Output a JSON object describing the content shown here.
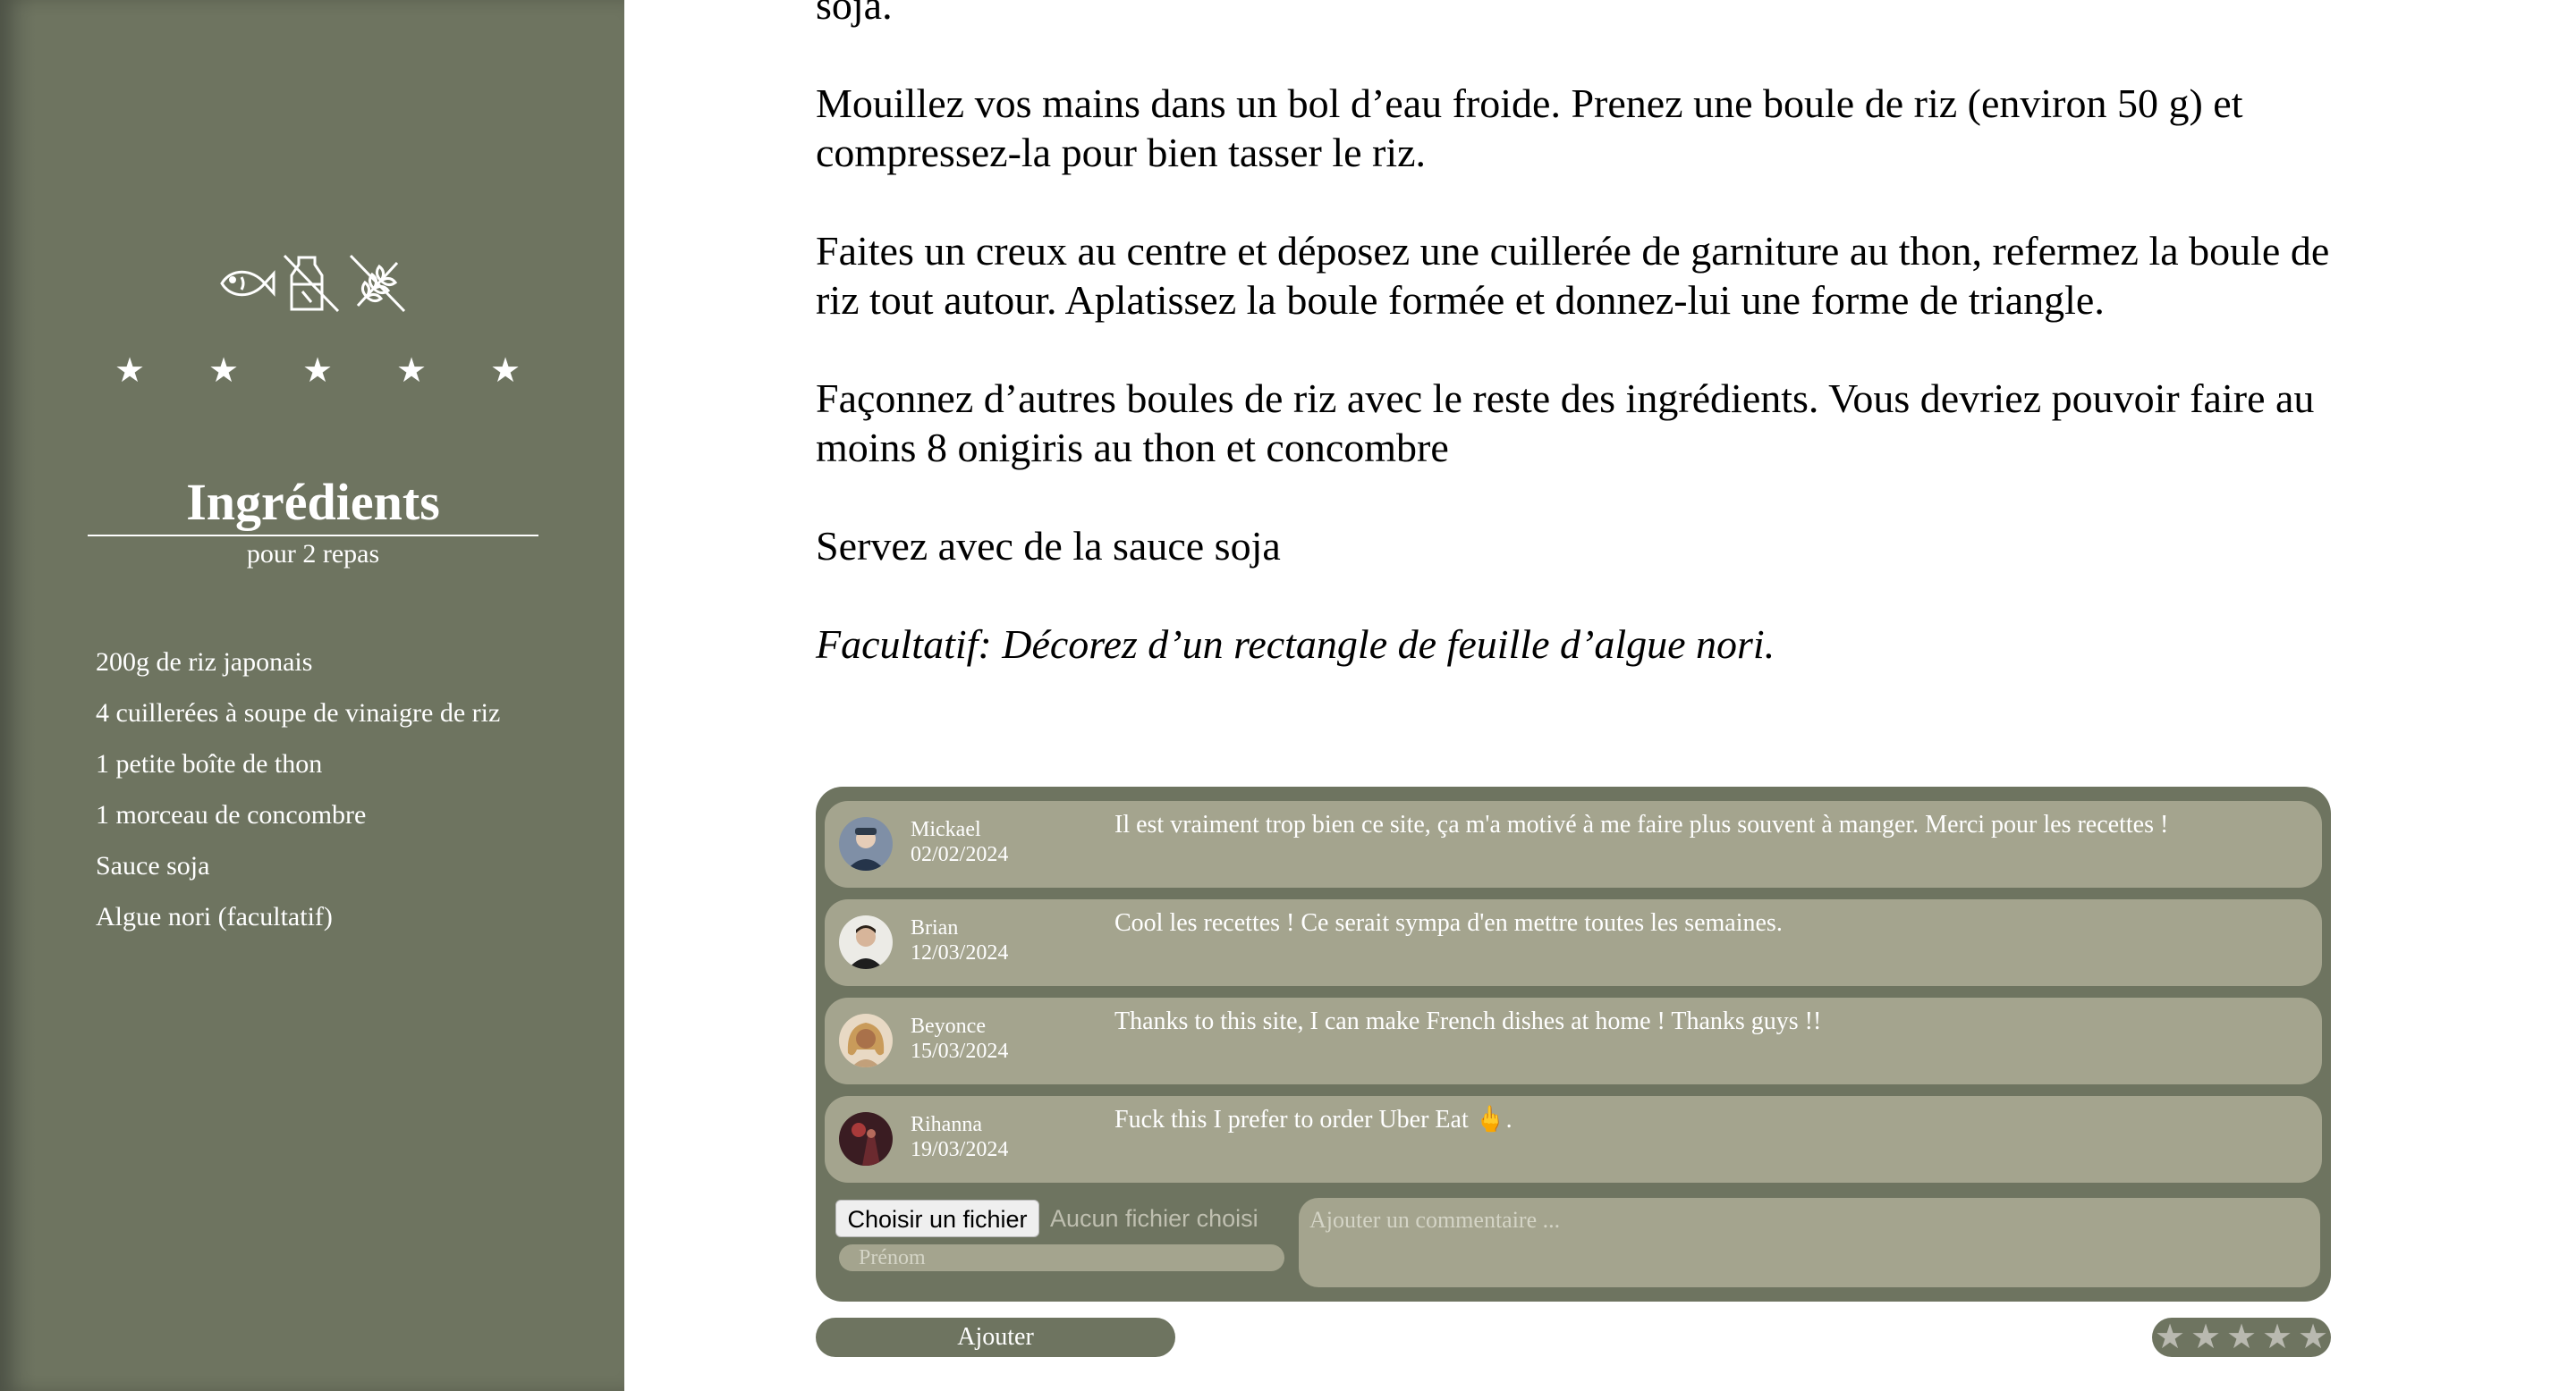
{
  "sidebar": {
    "icons": [
      "fish-icon",
      "no-dairy-icon",
      "no-gluten-icon"
    ],
    "stars": [
      "★",
      "★",
      "★",
      "★",
      "★"
    ],
    "ingredients_title": "Ingrédients",
    "portions": "pour 2 repas",
    "ingredients": [
      "200g de riz japonais",
      "4 cuillerées à soupe de vinaigre de riz",
      "1 petite boîte de thon",
      "1 morceau de concombre",
      "Sauce soja",
      "Algue nori (facultatif)"
    ]
  },
  "recipe": {
    "steps": [
      "soja.",
      "Mouillez vos mains dans un bol d’eau froide. Prenez une boule de riz (environ 50 g) et compressez-la pour bien tasser le riz.",
      "Faites un creux au centre et déposez une cuillerée de garniture au thon, refermez la boule de riz tout autour. Aplatissez la boule formée et donnez-lui une forme de triangle.",
      "Façonnez d’autres boules de riz avec le reste des ingrédients. Vous devriez pouvoir faire au moins 8 onigiris au thon et concombre",
      "Servez avec de la sauce soja"
    ],
    "optional_note": "Facultatif: Décorez d’un rectangle de feuille d’algue nori."
  },
  "comments": [
    {
      "name": "Mickael",
      "date": "02/02/2024",
      "text": "Il est vraiment trop bien ce site, ça m'a motivé à me faire plus souvent à manger. Merci pour les recettes !"
    },
    {
      "name": "Brian",
      "date": "12/03/2024",
      "text": "Cool les recettes ! Ce serait sympa d'en mettre toutes les semaines."
    },
    {
      "name": "Beyonce",
      "date": "15/03/2024",
      "text": "Thanks to this site, I can make French dishes at home ! Thanks guys !!"
    },
    {
      "name": "Rihanna",
      "date": "19/03/2024",
      "text": "Fuck this I prefer to order Uber Eat 🖕."
    }
  ],
  "form": {
    "file_button": "Choisir un fichier",
    "file_status": "Aucun fichier choisi",
    "name_placeholder": "Prénom",
    "comment_placeholder": "Ajouter un commentaire ...",
    "submit": "Ajouter",
    "rating_stars": [
      "★",
      "★",
      "★",
      "★",
      "★"
    ],
    "rating_value": 0
  },
  "colors": {
    "sidebar": "#6e7460",
    "comment_bg": "#a4a48e",
    "text": "#000000"
  }
}
